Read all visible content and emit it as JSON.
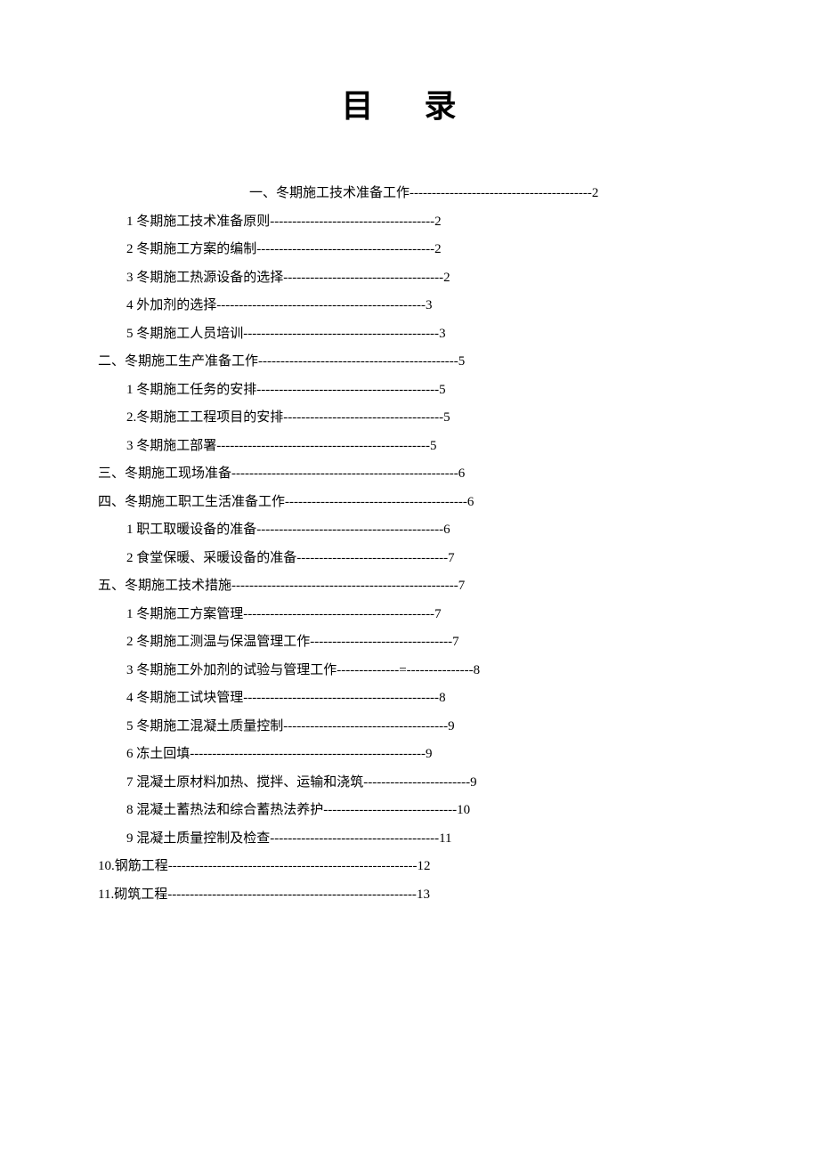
{
  "title": "目  录",
  "entries": [
    {
      "text": "一、冬期施工技术准备工作",
      "dashes": "-----------------------------------------",
      "page": "2",
      "cls": "first-entry"
    },
    {
      "text": "1 冬期施工技术准备原则",
      "dashes": "-------------------------------------",
      "page": "2",
      "cls": "indent-1"
    },
    {
      "text": "2 冬期施工方案的编制",
      "dashes": "----------------------------------------",
      "page": "2",
      "cls": "indent-1"
    },
    {
      "text": "3 冬期施工热源设备的选择",
      "dashes": "------------------------------------",
      "page": "2",
      "cls": "indent-1"
    },
    {
      "text": "4 外加剂的选择",
      "dashes": "-----------------------------------------------",
      "page": "3",
      "cls": "indent-1"
    },
    {
      "text": "5 冬期施工人员培训",
      "dashes": "--------------------------------------------",
      "page": "3",
      "cls": "indent-1"
    },
    {
      "text": "二、冬期施工生产准备工作",
      "dashes": "---------------------------------------------",
      "page": "5",
      "cls": "indent-0"
    },
    {
      "text": "1 冬期施工任务的安排",
      "dashes": "-----------------------------------------",
      "page": "5",
      "cls": "indent-1"
    },
    {
      "text": "2.冬期施工工程项目的安排",
      "dashes": "------------------------------------",
      "page": "5",
      "cls": "indent-1"
    },
    {
      "text": "3 冬期施工部署",
      "dashes": "------------------------------------------------",
      "page": "5",
      "cls": "indent-1"
    },
    {
      "text": "三、冬期施工现场准备",
      "dashes": "---------------------------------------------------",
      "page": "6",
      "cls": "indent-0"
    },
    {
      "text": "四、冬期施工职工生活准备工作",
      "dashes": "-----------------------------------------",
      "page": "6",
      "cls": "indent-0"
    },
    {
      "text": "1 职工取暖设备的准备",
      "dashes": "------------------------------------------",
      "page": "6",
      "cls": "indent-1"
    },
    {
      "text": "2 食堂保暖、采暖设备的准备",
      "dashes": "----------------------------------",
      "page": "7",
      "cls": "indent-1"
    },
    {
      "text": "五、冬期施工技术措施",
      "dashes": "---------------------------------------------------",
      "page": "7",
      "cls": "indent-0"
    },
    {
      "text": "1 冬期施工方案管理",
      "dashes": "-------------------------------------------",
      "page": "7",
      "cls": "indent-1"
    },
    {
      "text": "2 冬期施工测温与保温管理工作",
      "dashes": "--------------------------------",
      "page": "7",
      "cls": "indent-1"
    },
    {
      "text": "3 冬期施工外加剂的试验与管理工作",
      "dashes": "--------------=---------------",
      "page": "8",
      "cls": "indent-1"
    },
    {
      "text": "4 冬期施工试块管理",
      "dashes": "--------------------------------------------",
      "page": "8",
      "cls": "indent-1"
    },
    {
      "text": "5 冬期施工混凝土质量控制",
      "dashes": "-------------------------------------",
      "page": "9",
      "cls": "indent-1"
    },
    {
      "text": "6 冻土回填",
      "dashes": "-----------------------------------------------------",
      "page": "9",
      "cls": "indent-1"
    },
    {
      "text": "7 混凝土原材料加热、搅拌、运输和浇筑",
      "dashes": "------------------------",
      "page": "9",
      "cls": "indent-1"
    },
    {
      "text": "8 混凝土蓄热法和综合蓄热法养护",
      "dashes": "------------------------------",
      "page": "10",
      "cls": "indent-1"
    },
    {
      "text": "9 混凝土质量控制及检查",
      "dashes": "--------------------------------------",
      "page": "11",
      "cls": "indent-1"
    },
    {
      "text": "10.钢筋工程",
      "dashes": "--------------------------------------------------------",
      "page": "12",
      "cls": "indent-2"
    },
    {
      "text": "11.砌筑工程",
      "dashes": "--------------------------------------------------------",
      "page": "13",
      "cls": "indent-2"
    }
  ]
}
